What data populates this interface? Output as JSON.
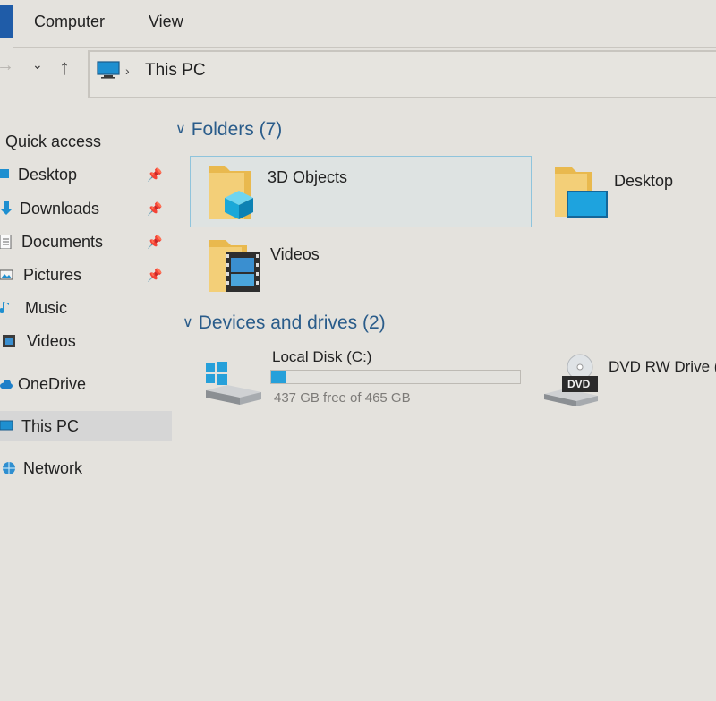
{
  "menu": {
    "computer": "Computer",
    "view": "View"
  },
  "nav": {
    "back_glyph": "→",
    "recent_glyph": "⌄",
    "up_glyph": "↑"
  },
  "address": {
    "separator": "›",
    "location": "This PC"
  },
  "sidebar": {
    "quick_access": "Quick access",
    "items": [
      {
        "label": "Desktop",
        "icon": "desktop-icon",
        "pinned": true
      },
      {
        "label": "Downloads",
        "icon": "downloads-icon",
        "pinned": true
      },
      {
        "label": "Documents",
        "icon": "documents-icon",
        "pinned": true
      },
      {
        "label": "Pictures",
        "icon": "pictures-icon",
        "pinned": true
      },
      {
        "label": "Music",
        "icon": "music-icon",
        "pinned": false
      },
      {
        "label": "Videos",
        "icon": "videos-icon",
        "pinned": false
      },
      {
        "label": "OneDrive",
        "icon": "onedrive-icon",
        "pinned": false
      },
      {
        "label": "This PC",
        "icon": "this-pc-icon",
        "pinned": false,
        "selected": true
      },
      {
        "label": "Network",
        "icon": "network-icon",
        "pinned": false
      }
    ],
    "pin_glyph": "📌"
  },
  "folders": {
    "header": "Folders (7)",
    "items": [
      {
        "label": "3D Objects",
        "icon": "3d-objects-folder-icon",
        "selected": true
      },
      {
        "label": "Desktop",
        "icon": "desktop-folder-icon"
      },
      {
        "label": "Videos",
        "icon": "videos-folder-icon"
      }
    ]
  },
  "drives": {
    "header": "Devices and drives (2)",
    "items": [
      {
        "label": "Local Disk (C:)",
        "free_text": "437 GB free of 465 GB",
        "used_fraction": 0.06,
        "icon": "windows-drive-icon"
      },
      {
        "label": "DVD RW Drive (",
        "icon": "dvd-drive-icon",
        "badge": "DVD"
      }
    ]
  },
  "colors": {
    "accent": "#26a0da",
    "header_text": "#2a5c8a",
    "folder": "#f2c86a"
  }
}
